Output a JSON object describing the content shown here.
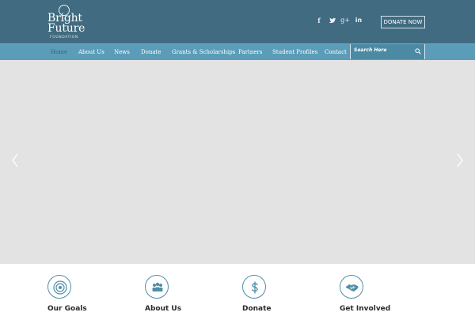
{
  "header": {
    "logo": {
      "line1": "Bright",
      "line2": "Future",
      "line3": "FOUNDATION"
    },
    "social": {
      "facebook": "f",
      "twitter": "t",
      "google_plus": "g+",
      "linkedin": "in"
    },
    "donate_button": "DONATE NOW"
  },
  "nav": {
    "items": [
      {
        "label": "Home",
        "active": true
      },
      {
        "label": "About Us"
      },
      {
        "label": "News"
      },
      {
        "label": "Donate"
      },
      {
        "label": "Grants & Scholarships"
      },
      {
        "label": "Partners"
      },
      {
        "label": "Student Profiles"
      },
      {
        "label": "Contact"
      }
    ],
    "search": {
      "placeholder": "Search Here",
      "icon": "search-icon"
    }
  },
  "slider": {
    "prev_icon": "chevron-left-icon",
    "next_icon": "chevron-right-icon"
  },
  "features": [
    {
      "title": "Our Goals",
      "icon": "target-icon"
    },
    {
      "title": "About Us",
      "icon": "group-icon"
    },
    {
      "title": "Donate",
      "icon": "dollar-icon"
    },
    {
      "title": "Get Involved",
      "icon": "handshake-icon"
    }
  ],
  "colors": {
    "header_bg": "#416b80",
    "nav_bg": "#5b9db8",
    "accent": "#4f8ea8",
    "slider_bg": "#e3e3e3"
  }
}
